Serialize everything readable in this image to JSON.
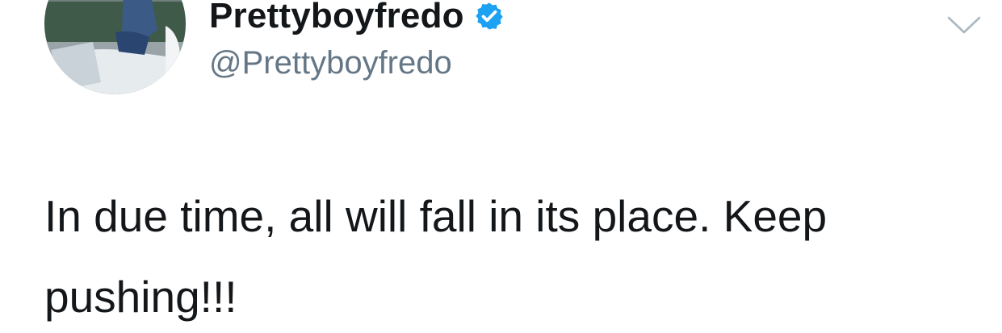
{
  "tweet": {
    "display_name": "Prettyboyfredo",
    "handle": "@Prettyboyfredo",
    "verified": true,
    "text_line1": "In due time, all will fall in its place. Keep",
    "text_line2": "pushing!!!"
  },
  "icons": {
    "verified": "verified-badge-icon",
    "caret": "chevron-down-icon"
  },
  "colors": {
    "verified_blue": "#1da1f2",
    "text": "#14171a",
    "secondary_text": "#657786",
    "caret": "#aab8c2"
  }
}
